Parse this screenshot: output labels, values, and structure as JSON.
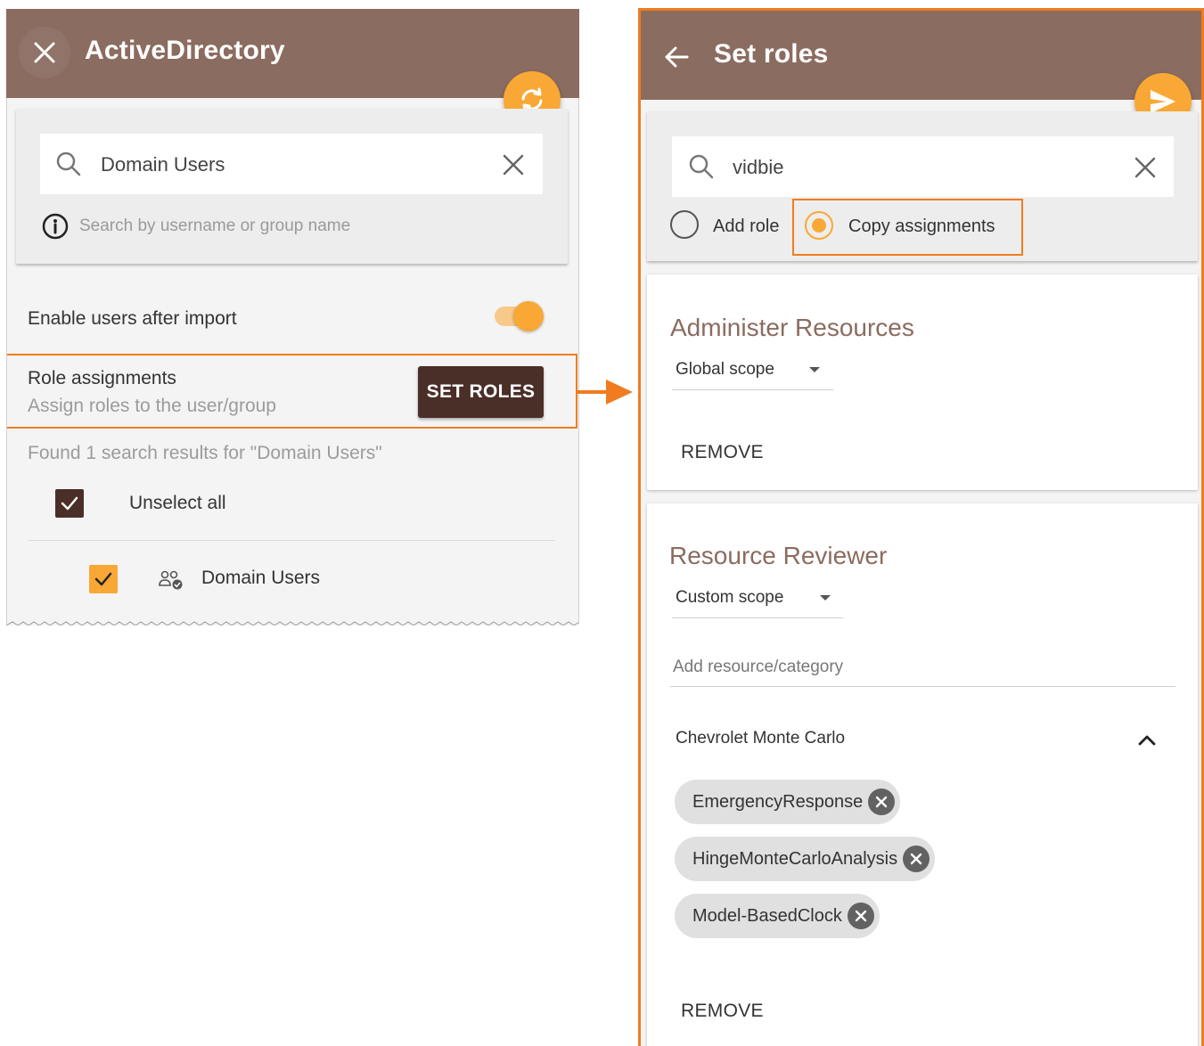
{
  "left_panel": {
    "title": "ActiveDirectory",
    "search": {
      "value": "Domain Users",
      "hint": "Search by username or group name"
    },
    "enable_users_label": "Enable users after import",
    "enable_users_on": true,
    "role_assignments": {
      "label": "Role assignments",
      "sublabel": "Assign roles to the user/group",
      "button": "SET ROLES"
    },
    "results_text": "Found 1 search results for \"Domain Users\"",
    "unselect_all": "Unselect all",
    "results": [
      {
        "name": "Domain Users",
        "checked": true
      }
    ]
  },
  "right_panel": {
    "title": "Set roles",
    "search_value": "vidbie",
    "radio_options": [
      {
        "label": "Add role",
        "selected": false
      },
      {
        "label": "Copy assignments",
        "selected": true
      }
    ],
    "roles": [
      {
        "title": "Administer Resources",
        "scope": "Global scope",
        "remove": "REMOVE"
      },
      {
        "title": "Resource Reviewer",
        "scope": "Custom scope",
        "add_resource_placeholder": "Add resource/category",
        "resource_group": "Chevrolet Monte Carlo",
        "chips": [
          "EmergencyResponse",
          "HingeMonteCarloAnalysis",
          "Model-BasedClock"
        ],
        "remove": "REMOVE"
      }
    ]
  },
  "colors": {
    "appbar": "#8b6c60",
    "accent": "#f9a836",
    "highlight_border": "#f07c1f",
    "dark_button": "#4a2e28"
  },
  "icons": [
    "close-icon",
    "refresh-icon",
    "search-icon",
    "clear-icon",
    "info-icon",
    "check-icon",
    "group-icon",
    "back-arrow-icon",
    "send-icon",
    "chevron-up-icon",
    "chip-remove-icon",
    "right-arrow-icon"
  ]
}
